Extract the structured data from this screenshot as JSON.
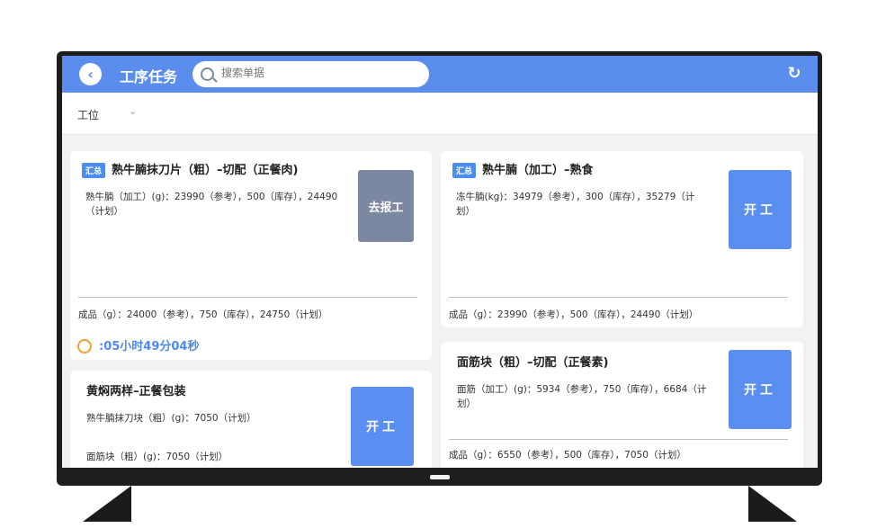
{
  "header": {
    "title": "工序任务",
    "search_placeholder": "搜索单据",
    "back_icon": "chevron-left-icon",
    "refresh_icon": "refresh-icon"
  },
  "filter": {
    "label": "工位"
  },
  "cards": {
    "c1": {
      "tag": "汇总",
      "title": "熟牛腩抹刀片（粗）–切配（正餐肉)",
      "desc": "熟牛腩（加工）(g)：23990（参考），500（库存），24490（计划）",
      "footer": "成品（g）：24000（参考），750（库存），24750（计划）",
      "timer": ":05小时49分04秒",
      "button": "去报工"
    },
    "c2": {
      "tag": "汇总",
      "title": "熟牛腩（加工）–熟食",
      "desc": "冻牛腩(kg)：34979（参考），300（库存），35279（计划）",
      "footer": "成品（g）：23990（参考），500（库存），24490（计划）",
      "button": "开工"
    },
    "c3": {
      "title": "黄焖两样–正餐包装",
      "desc1": "熟牛腩抹刀块（粗）(g)：7050（计划）",
      "desc2": "面筋块（粗）(g)：7050（计划）",
      "button": "开工"
    },
    "c4": {
      "title": "面筋块（粗）–切配（正餐素)",
      "desc": "面筋（加工）(g)：5934（参考），750（库存），6684（计划）",
      "footer": "成品（g）：6550（参考），500（库存），7050（计划）",
      "button": "开工"
    }
  },
  "colors": {
    "accent": "#5b8def",
    "button_blue": "#5a8ef0",
    "button_grey": "#7c87a1",
    "timer": "#4f8aef"
  }
}
